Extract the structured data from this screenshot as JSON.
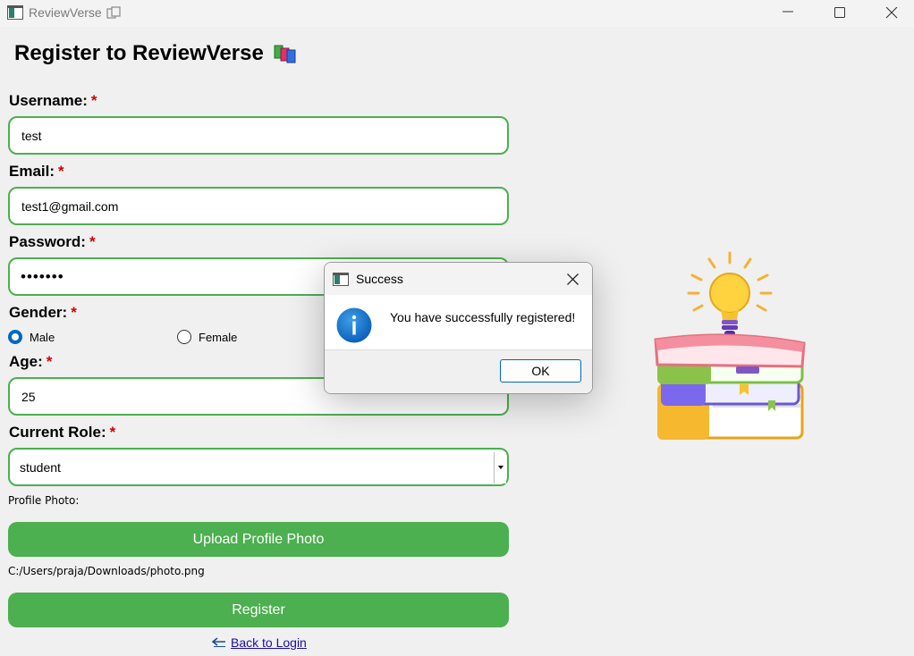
{
  "window": {
    "title": "ReviewVerse"
  },
  "form": {
    "heading": "Register to ReviewVerse",
    "required_mark": "*",
    "username": {
      "label": "Username:",
      "value": "test"
    },
    "email": {
      "label": "Email:",
      "value": "test1@gmail.com"
    },
    "password": {
      "label": "Password:",
      "masked_value": "•••••••"
    },
    "gender": {
      "label": "Gender:",
      "options": [
        "Male",
        "Female"
      ],
      "selected": "Male"
    },
    "age": {
      "label": "Age:",
      "value": "25"
    },
    "role": {
      "label": "Current Role:",
      "value": "student"
    },
    "photo": {
      "label": "Profile Photo:",
      "upload_label": "Upload Profile Photo",
      "path": "C:/Users/praja/Downloads/photo.png"
    },
    "register_label": "Register",
    "back_label": "Back to Login"
  },
  "dialog": {
    "title": "Success",
    "message": "You have successfully registered!",
    "ok_label": "OK"
  },
  "colors": {
    "accent_green": "#4caf50",
    "required_red": "#d00000",
    "link_blue": "#1a0dab",
    "info_blue": "#0067c0"
  },
  "icons": [
    "app-window-icon",
    "books-emoji-icon",
    "minimize-icon",
    "maximize-icon",
    "close-icon",
    "radio-icon",
    "dropdown-arrow-icon",
    "back-arrow-icon",
    "info-icon",
    "books-lightbulb-illustration"
  ]
}
